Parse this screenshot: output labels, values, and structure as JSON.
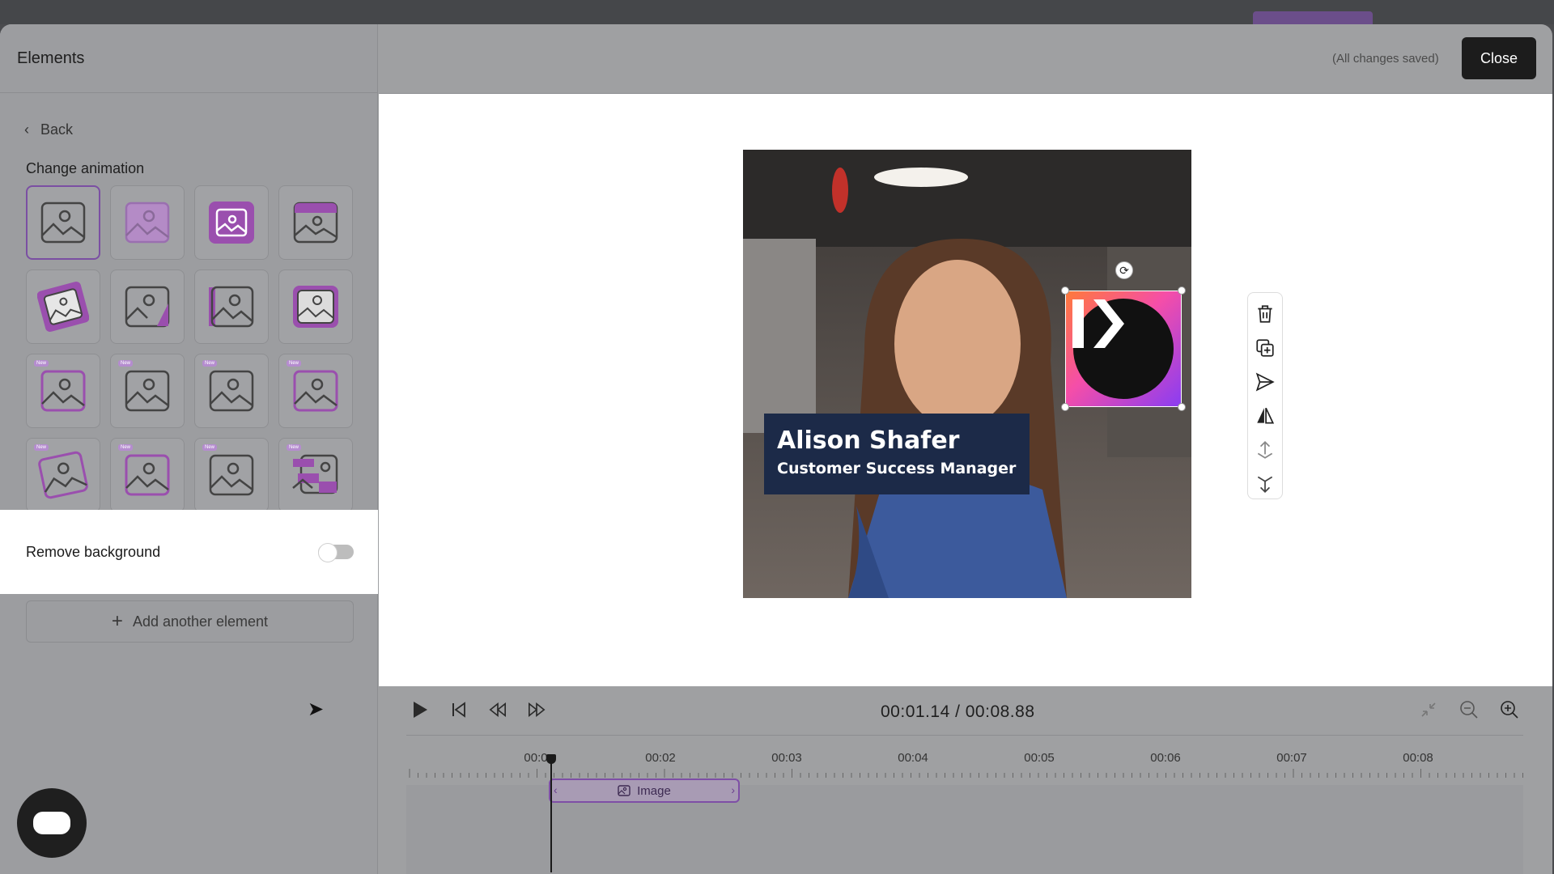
{
  "panel": {
    "title": "Elements",
    "back_label": "Back",
    "section_label": "Change animation",
    "new_badge": "New",
    "remove_background_label": "Remove background",
    "remove_background_on": false,
    "add_element_label": "Add another element"
  },
  "header": {
    "save_status": "(All changes saved)",
    "close_label": "Close"
  },
  "canvas": {
    "person_name": "Alison Shafer",
    "person_role": "Customer Success Manager"
  },
  "side_tools": [
    "trash-icon",
    "duplicate-icon",
    "send-icon",
    "flip-icon",
    "bring-forward-icon",
    "send-backward-icon"
  ],
  "timeline": {
    "timecode": "00:01.14 / 00:08.88",
    "tick_labels": [
      "00:0",
      "00:02",
      "00:03",
      "00:04",
      "00:05",
      "00:06",
      "00:07",
      "00:08"
    ],
    "clip_label": "Image"
  },
  "colors": {
    "accent": "#7b4fa3",
    "name_card": "#1c2a48",
    "close_button": "#1c1c1c"
  }
}
